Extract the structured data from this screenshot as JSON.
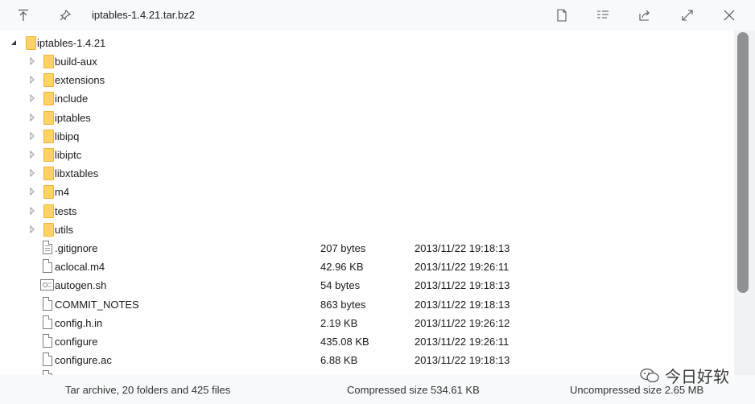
{
  "title": "iptables-1.4.21.tar.bz2",
  "toolbar_icons": [
    "go-up-icon",
    "pin-icon",
    "new-file-icon",
    "list-view-icon",
    "share-icon",
    "expand-icon",
    "close-icon"
  ],
  "root": {
    "name": "iptables-1.4.21"
  },
  "folders": [
    "build-aux",
    "extensions",
    "include",
    "iptables",
    "libipq",
    "libiptc",
    "libxtables",
    "m4",
    "tests",
    "utils"
  ],
  "files": [
    {
      "name": ".gitignore",
      "size": "207 bytes",
      "date": "2013/11/22 19:18:13",
      "icon": "text-file-icon"
    },
    {
      "name": "aclocal.m4",
      "size": "42.96 KB",
      "date": "2013/11/22 19:26:11",
      "icon": "file-icon"
    },
    {
      "name": "autogen.sh",
      "size": "54 bytes",
      "date": "2013/11/22 19:18:13",
      "icon": "script-file-icon"
    },
    {
      "name": "COMMIT_NOTES",
      "size": "863 bytes",
      "date": "2013/11/22 19:18:13",
      "icon": "file-icon"
    },
    {
      "name": "config.h.in",
      "size": "2.19 KB",
      "date": "2013/11/22 19:26:12",
      "icon": "file-icon"
    },
    {
      "name": "configure",
      "size": "435.08 KB",
      "date": "2013/11/22 19:26:11",
      "icon": "file-icon"
    },
    {
      "name": "configure.ac",
      "size": "6.88 KB",
      "date": "2013/11/22 19:18:13",
      "icon": "file-icon"
    }
  ],
  "status": {
    "summary": "Tar archive, 20 folders and 425 files",
    "compressed": "Compressed size 534.61 KB",
    "uncompressed": "Uncompressed size 2.65 MB"
  },
  "watermark": "今日好软"
}
